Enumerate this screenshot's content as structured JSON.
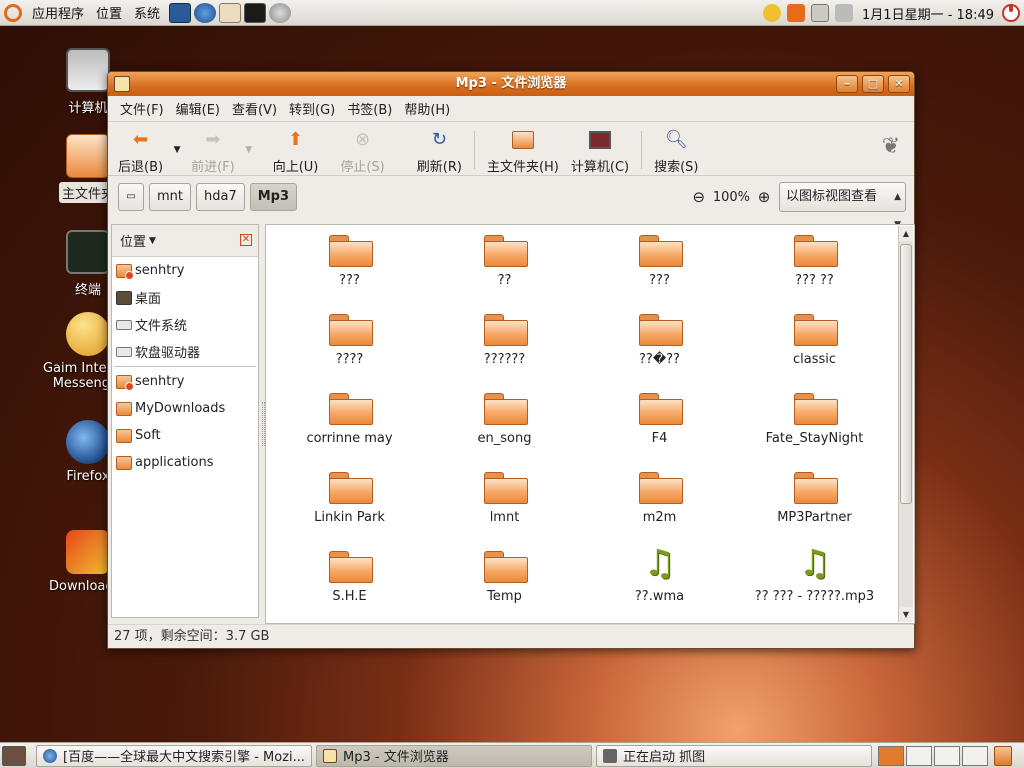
{
  "top_panel": {
    "menus": [
      "应用程序",
      "位置",
      "系统"
    ],
    "launchers": [
      "system-monitor-icon",
      "firefox-icon",
      "mail-icon",
      "terminal-icon",
      "settings-icon"
    ],
    "clock": "1月1日星期一 - 18:49"
  },
  "desktop": {
    "icons": [
      {
        "label": "计算机",
        "icon": "computer-icon",
        "selected": false
      },
      {
        "label": "主文件夹",
        "icon": "home-folder-icon",
        "selected": true
      },
      {
        "label": "终端",
        "icon": "terminal-icon",
        "selected": false
      },
      {
        "label": "Gaim Internet Messenger",
        "icon": "gaim-icon",
        "selected": false
      },
      {
        "label": "Firefox",
        "icon": "firefox-icon",
        "selected": false
      },
      {
        "label": "Downloader",
        "icon": "downloader-icon",
        "selected": false
      }
    ]
  },
  "window": {
    "title": "Mp3 - 文件浏览器",
    "menu": [
      "文件(F)",
      "编辑(E)",
      "查看(V)",
      "转到(G)",
      "书签(B)",
      "帮助(H)"
    ],
    "toolbar": {
      "back": "后退(B)",
      "forward": "前进(F)",
      "up": "向上(U)",
      "stop": "停止(S)",
      "reload": "刷新(R)",
      "home": "主文件夹(H)",
      "computer": "计算机(C)",
      "search": "搜索(S)"
    },
    "breadcrumbs": [
      "mnt",
      "hda7",
      "Mp3"
    ],
    "zoom": "100%",
    "view_mode": "以图标视图查看",
    "side_pane": {
      "title": "位置",
      "items_group1": [
        {
          "label": "senhtry",
          "icon": "home"
        },
        {
          "label": "桌面",
          "icon": "desktop"
        },
        {
          "label": "文件系统",
          "icon": "drive"
        },
        {
          "label": "软盘驱动器",
          "icon": "drive"
        }
      ],
      "items_group2": [
        {
          "label": "senhtry",
          "icon": "home"
        },
        {
          "label": "MyDownloads",
          "icon": "folder"
        },
        {
          "label": "Soft",
          "icon": "folder"
        },
        {
          "label": "applications",
          "icon": "folder"
        }
      ]
    },
    "files": [
      {
        "name": "???",
        "type": "folder"
      },
      {
        "name": "??",
        "type": "folder"
      },
      {
        "name": "???",
        "type": "folder"
      },
      {
        "name": "??? ??",
        "type": "folder"
      },
      {
        "name": "????",
        "type": "folder"
      },
      {
        "name": "??????",
        "type": "folder"
      },
      {
        "name": "??�??",
        "type": "folder"
      },
      {
        "name": "classic",
        "type": "folder"
      },
      {
        "name": "corrinne may",
        "type": "folder"
      },
      {
        "name": "en_song",
        "type": "folder"
      },
      {
        "name": "F4",
        "type": "folder"
      },
      {
        "name": "Fate_StayNight",
        "type": "folder"
      },
      {
        "name": "Linkin Park",
        "type": "folder"
      },
      {
        "name": "lmnt",
        "type": "folder"
      },
      {
        "name": "m2m",
        "type": "folder"
      },
      {
        "name": "MP3Partner",
        "type": "folder"
      },
      {
        "name": "S.H.E",
        "type": "folder"
      },
      {
        "name": "Temp",
        "type": "folder"
      },
      {
        "name": "??.wma",
        "type": "audio"
      },
      {
        "name": "?? ??? - ?????.mp3",
        "type": "audio"
      }
    ],
    "status": "27 项，剩余空间：3.7 GB"
  },
  "bottom_panel": {
    "tasks": [
      {
        "label": "[百度——全球最大中文搜索引擎 - Mozi...",
        "active": false
      },
      {
        "label": "Mp3 - 文件浏览器",
        "active": true
      },
      {
        "label": "正在启动 抓图",
        "active": false
      }
    ]
  },
  "colors": {
    "accent": "#d86d1e",
    "folder": "#f6a866",
    "audio": "#7c9a1c"
  }
}
